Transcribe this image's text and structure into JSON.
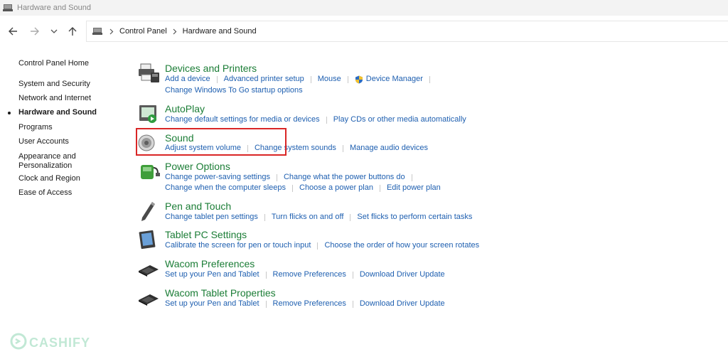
{
  "window": {
    "title": "Hardware and Sound"
  },
  "icons": {
    "window": "control-panel-icon",
    "back": "arrow-left-icon",
    "forward": "arrow-right-icon",
    "recent": "chevron-down-icon",
    "up": "arrow-up-icon",
    "address": "control-panel-icon",
    "crumb_separator": "chevron-right-icon"
  },
  "address_bar": {
    "crumbs": [
      "Control Panel",
      "Hardware and Sound"
    ]
  },
  "left_nav": {
    "home": "Control Panel Home",
    "items": [
      {
        "label": "System and Security",
        "active": false
      },
      {
        "label": "Network and Internet",
        "active": false
      },
      {
        "label": "Hardware and Sound",
        "active": true
      },
      {
        "label": "Programs",
        "active": false
      },
      {
        "label": "User Accounts",
        "active": false
      },
      {
        "label": "Appearance and\nPersonalization",
        "active": false
      },
      {
        "label": "Clock and Region",
        "active": false
      },
      {
        "label": "Ease of Access",
        "active": false
      }
    ]
  },
  "categories": [
    {
      "title": "Devices and Printers",
      "icon": "printer-icon",
      "lines": [
        [
          "Add a device",
          "Advanced printer setup",
          "Mouse",
          "Device Manager"
        ],
        [
          "Change Windows To Go startup options"
        ]
      ]
    },
    {
      "title": "AutoPlay",
      "icon": "autoplay-icon",
      "lines": [
        [
          "Change default settings for media or devices",
          "Play CDs or other media automatically"
        ]
      ]
    },
    {
      "title": "Sound",
      "icon": "speaker-icon",
      "lines": [
        [
          "Adjust system volume",
          "Change system sounds",
          "Manage audio devices"
        ]
      ]
    },
    {
      "title": "Power Options",
      "icon": "power-options-icon",
      "lines": [
        [
          "Change power-saving settings",
          "Change what the power buttons do"
        ],
        [
          "Change when the computer sleeps",
          "Choose a power plan",
          "Edit power plan"
        ]
      ]
    },
    {
      "title": "Pen and Touch",
      "icon": "pen-icon",
      "lines": [
        [
          "Change tablet pen settings",
          "Turn flicks on and off",
          "Set flicks to perform certain tasks"
        ]
      ]
    },
    {
      "title": "Tablet PC Settings",
      "icon": "tablet-icon",
      "lines": [
        [
          "Calibrate the screen for pen or touch input",
          "Choose the order of how your screen rotates"
        ]
      ]
    },
    {
      "title": "Wacom Preferences",
      "icon": "wacom-tablet-icon",
      "lines": [
        [
          "Set up your Pen and Tablet",
          "Remove Preferences",
          "Download Driver Update"
        ]
      ]
    },
    {
      "title": "Wacom Tablet Properties",
      "icon": "wacom-tablet-icon",
      "lines": [
        [
          "Set up your Pen and Tablet",
          "Remove Preferences",
          "Download Driver Update"
        ]
      ]
    }
  ],
  "watermark": {
    "text": "CASHIFY"
  },
  "colors": {
    "category_title": "#1b7d36",
    "link": "#1e5fb0",
    "highlight": "#d92626",
    "watermark": "#8fd6b3"
  }
}
